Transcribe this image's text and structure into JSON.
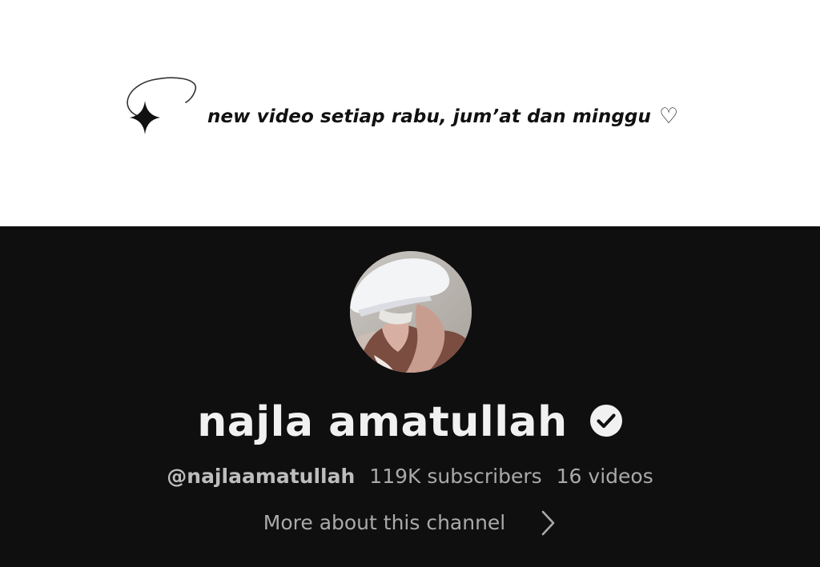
{
  "banner": {
    "tagline": "new video setiap rabu, jum’at dan minggu",
    "heart_glyph": "♡",
    "background_color": "#ffffff",
    "text_color": "#111111"
  },
  "channel": {
    "name": "najla amatullah",
    "handle": "@najlaamatullah",
    "subscribers": "119K subscribers",
    "videos": "16 videos",
    "more_link": "More about this channel",
    "avatar_icon": "profile-photo",
    "verified_icon": "verified-check-icon",
    "chevron_icon": "chevron-right-icon",
    "background_color": "#0f0f0f",
    "name_color": "#f1f1f1",
    "secondary_text_color": "#aaaaaa"
  }
}
